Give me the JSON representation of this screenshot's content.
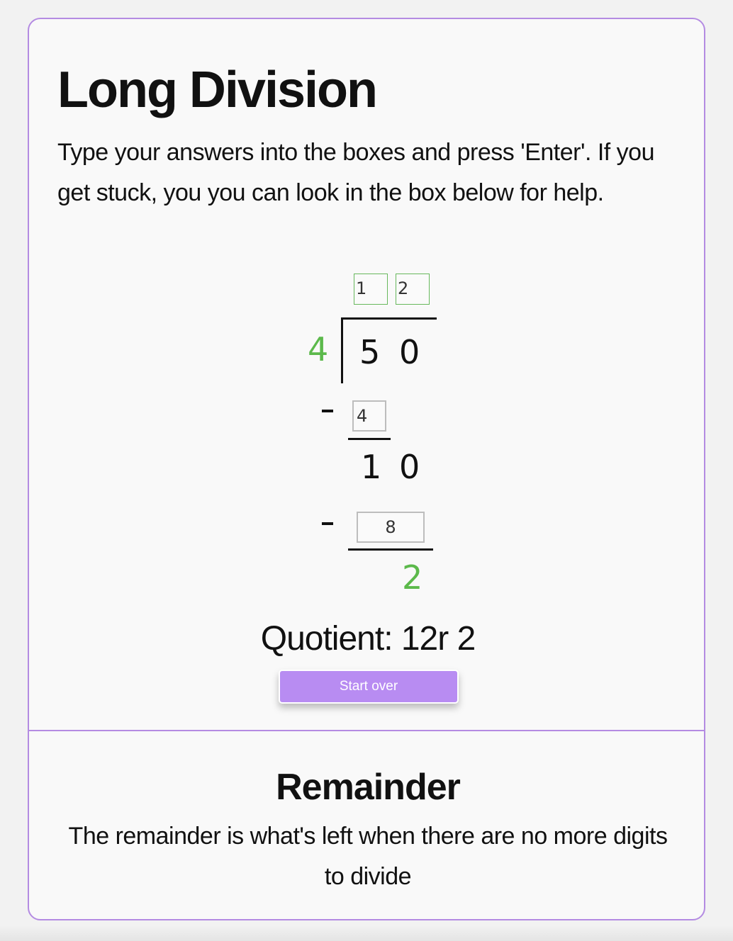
{
  "title": "Long Division",
  "instructions": "Type your answers into the boxes and press 'Enter'. If you get stuck, you you can look in the box below for help.",
  "problem": {
    "divisor": "4",
    "dividend_digits": [
      "5",
      "0"
    ],
    "quotient_inputs": [
      "1",
      "2"
    ],
    "steps": [
      {
        "subtract_sign": "-",
        "subtract_value": "4",
        "result_digits": [
          "1",
          "0"
        ]
      },
      {
        "subtract_sign": "-",
        "subtract_value": "8",
        "result_digits": [
          "2"
        ]
      }
    ],
    "quotient_text": "Quotient: 12r 2"
  },
  "controls": {
    "start_over_label": "Start over"
  },
  "help": {
    "title": "Remainder",
    "text": "The remainder is what's left when there are no more digits to divide"
  },
  "colors": {
    "accent": "#b48be2",
    "button": "#b88cf2",
    "correct": "#5cb94b"
  }
}
